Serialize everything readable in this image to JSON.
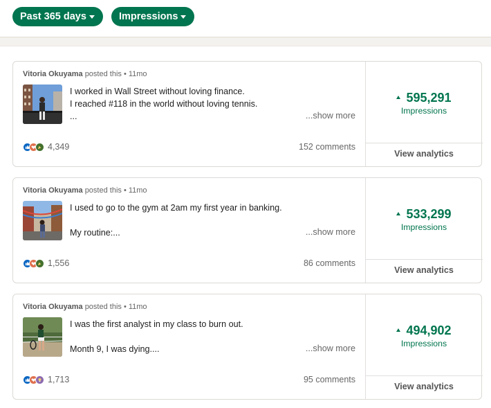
{
  "filters": {
    "date_range": "Past 365 days",
    "metric": "Impressions"
  },
  "colors": {
    "brand_green": "#01754f",
    "like_blue": "#0a66c2",
    "love_red": "#df704d",
    "celebrate_green": "#44712e",
    "insightful_purple": "#8d6bb0"
  },
  "posts": [
    {
      "author": "Vitoria Okuyama",
      "meta": "posted this • 11mo",
      "lines": [
        "I worked in Wall Street without loving finance.",
        "I reached #118 in the world without loving tennis.",
        "..."
      ],
      "show_more": "...show more",
      "reactions_count": "4,349",
      "reaction_icons": [
        "like-icon",
        "love-icon",
        "celebrate-icon"
      ],
      "comments": "152 comments",
      "impressions": "595,291",
      "impressions_label": "Impressions",
      "view_analytics": "View analytics"
    },
    {
      "author": "Vitoria Okuyama",
      "meta": "posted this • 11mo",
      "lines": [
        "I used to go to the gym at 2am my first year in banking.",
        "",
        "My routine:..."
      ],
      "show_more": "...show more",
      "reactions_count": "1,556",
      "reaction_icons": [
        "like-icon",
        "love-icon",
        "celebrate-icon"
      ],
      "comments": "86 comments",
      "impressions": "533,299",
      "impressions_label": "Impressions",
      "view_analytics": "View analytics"
    },
    {
      "author": "Vitoria Okuyama",
      "meta": "posted this • 11mo",
      "lines": [
        "I was the first analyst in my class to burn out.",
        "",
        "Month 9, I was dying...."
      ],
      "show_more": "...show more",
      "reactions_count": "1,713",
      "reaction_icons": [
        "like-icon",
        "love-icon",
        "insightful-icon"
      ],
      "comments": "95 comments",
      "impressions": "494,902",
      "impressions_label": "Impressions",
      "view_analytics": "View analytics"
    }
  ]
}
